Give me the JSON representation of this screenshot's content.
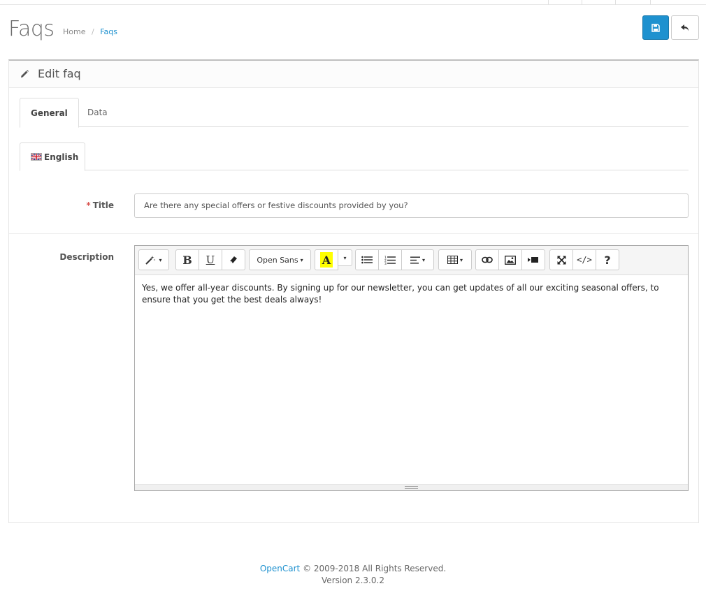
{
  "page": {
    "title": "Faqs",
    "breadcrumb": [
      "Home",
      "/",
      "Faqs"
    ]
  },
  "panel": {
    "heading": "Edit faq",
    "tabs": [
      "General",
      "Data"
    ],
    "language_tab": "English"
  },
  "form": {
    "title_label": "Title",
    "required_mark": "*",
    "title_value": "Are there any special offers or festive discounts provided by you?",
    "description_label": "Description",
    "font_name": "Open Sans",
    "description_text": "Yes, we offer all-year discounts. By signing up for our newsletter, you can get updates of all our exciting seasonal offers, to ensure that you get the best deals always!"
  },
  "toolbar": {
    "bold": "B",
    "underline": "U",
    "color_letter": "A",
    "code": "</>",
    "help": "?",
    "highlight_color": "#ffff00"
  },
  "footer": {
    "brand": "OpenCart",
    "copyright": " © 2009-2018 All Rights Reserved.",
    "version": "Version 2.3.0.2"
  },
  "colors": {
    "primary": "#1e91cf",
    "required": "#d9534f"
  }
}
